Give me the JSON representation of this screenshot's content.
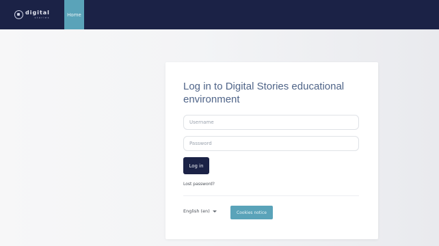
{
  "header": {
    "brand_main": "digital",
    "brand_sub": "stories",
    "nav_home": "Home"
  },
  "login": {
    "title": "Log in to Digital Stories educational environment",
    "username_placeholder": "Username",
    "password_placeholder": "Password",
    "login_label": "Log in",
    "forgot_label": "Lost password?",
    "language_label": "English (en)",
    "cookies_label": "Cookies notice"
  },
  "colors": {
    "navbar": "#1b2246",
    "accent": "#5aa3b9",
    "title": "#4f6488"
  },
  "icons": {
    "brand": "logo-icon",
    "language_dropdown": "caret-down-icon"
  }
}
